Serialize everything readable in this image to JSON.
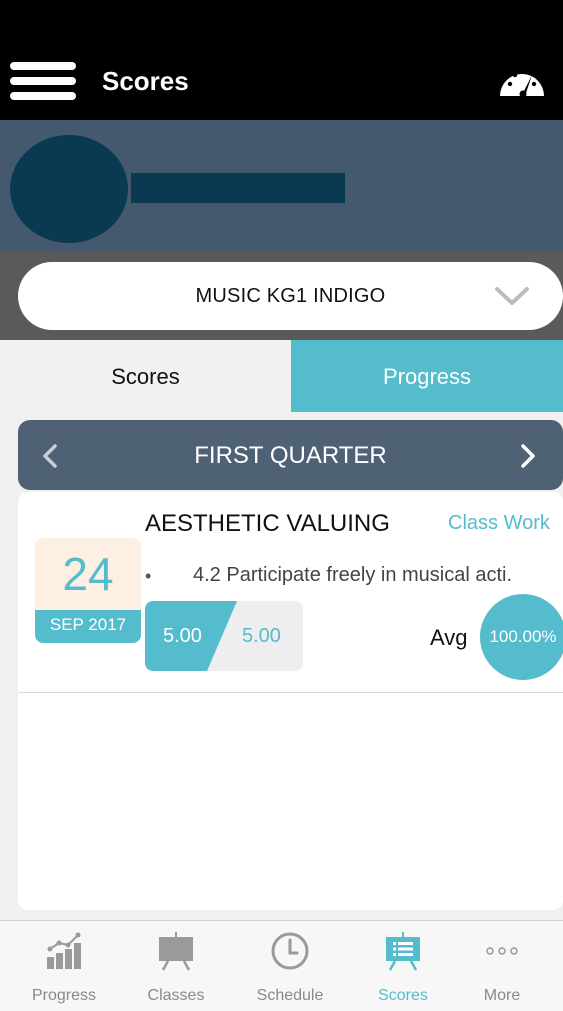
{
  "header": {
    "title": "Scores"
  },
  "course_selector": {
    "selected": "MUSIC KG1 INDIGO"
  },
  "tabs": [
    {
      "label": "Scores",
      "active": false
    },
    {
      "label": "Progress",
      "active": true
    }
  ],
  "period": {
    "label": "FIRST QUARTER"
  },
  "items": [
    {
      "title": "AESTHETIC VALUING",
      "type": "Class Work",
      "day": "24",
      "month_year": "SEP 2017",
      "bullet": "•",
      "description": "4.2 Participate freely in musical acti.",
      "score": "5.00",
      "max_score": "5.00",
      "avg_label": "Avg",
      "avg_value": "100.00%",
      "score_fraction": 1.0
    }
  ],
  "bottom_nav": [
    {
      "label": "Progress",
      "icon": "progress-chart-icon",
      "active": false
    },
    {
      "label": "Classes",
      "icon": "classes-board-icon",
      "active": false
    },
    {
      "label": "Schedule",
      "icon": "clock-icon",
      "active": false
    },
    {
      "label": "Scores",
      "icon": "scores-board-icon",
      "active": true
    },
    {
      "label": "More",
      "icon": "more-dots-icon",
      "active": false
    }
  ],
  "colors": {
    "accent": "#54bccd",
    "header_bg": "#000000",
    "profile_bg": "#44596d",
    "quarter_bg": "#4f6174",
    "avatar": "#0a3a52"
  }
}
